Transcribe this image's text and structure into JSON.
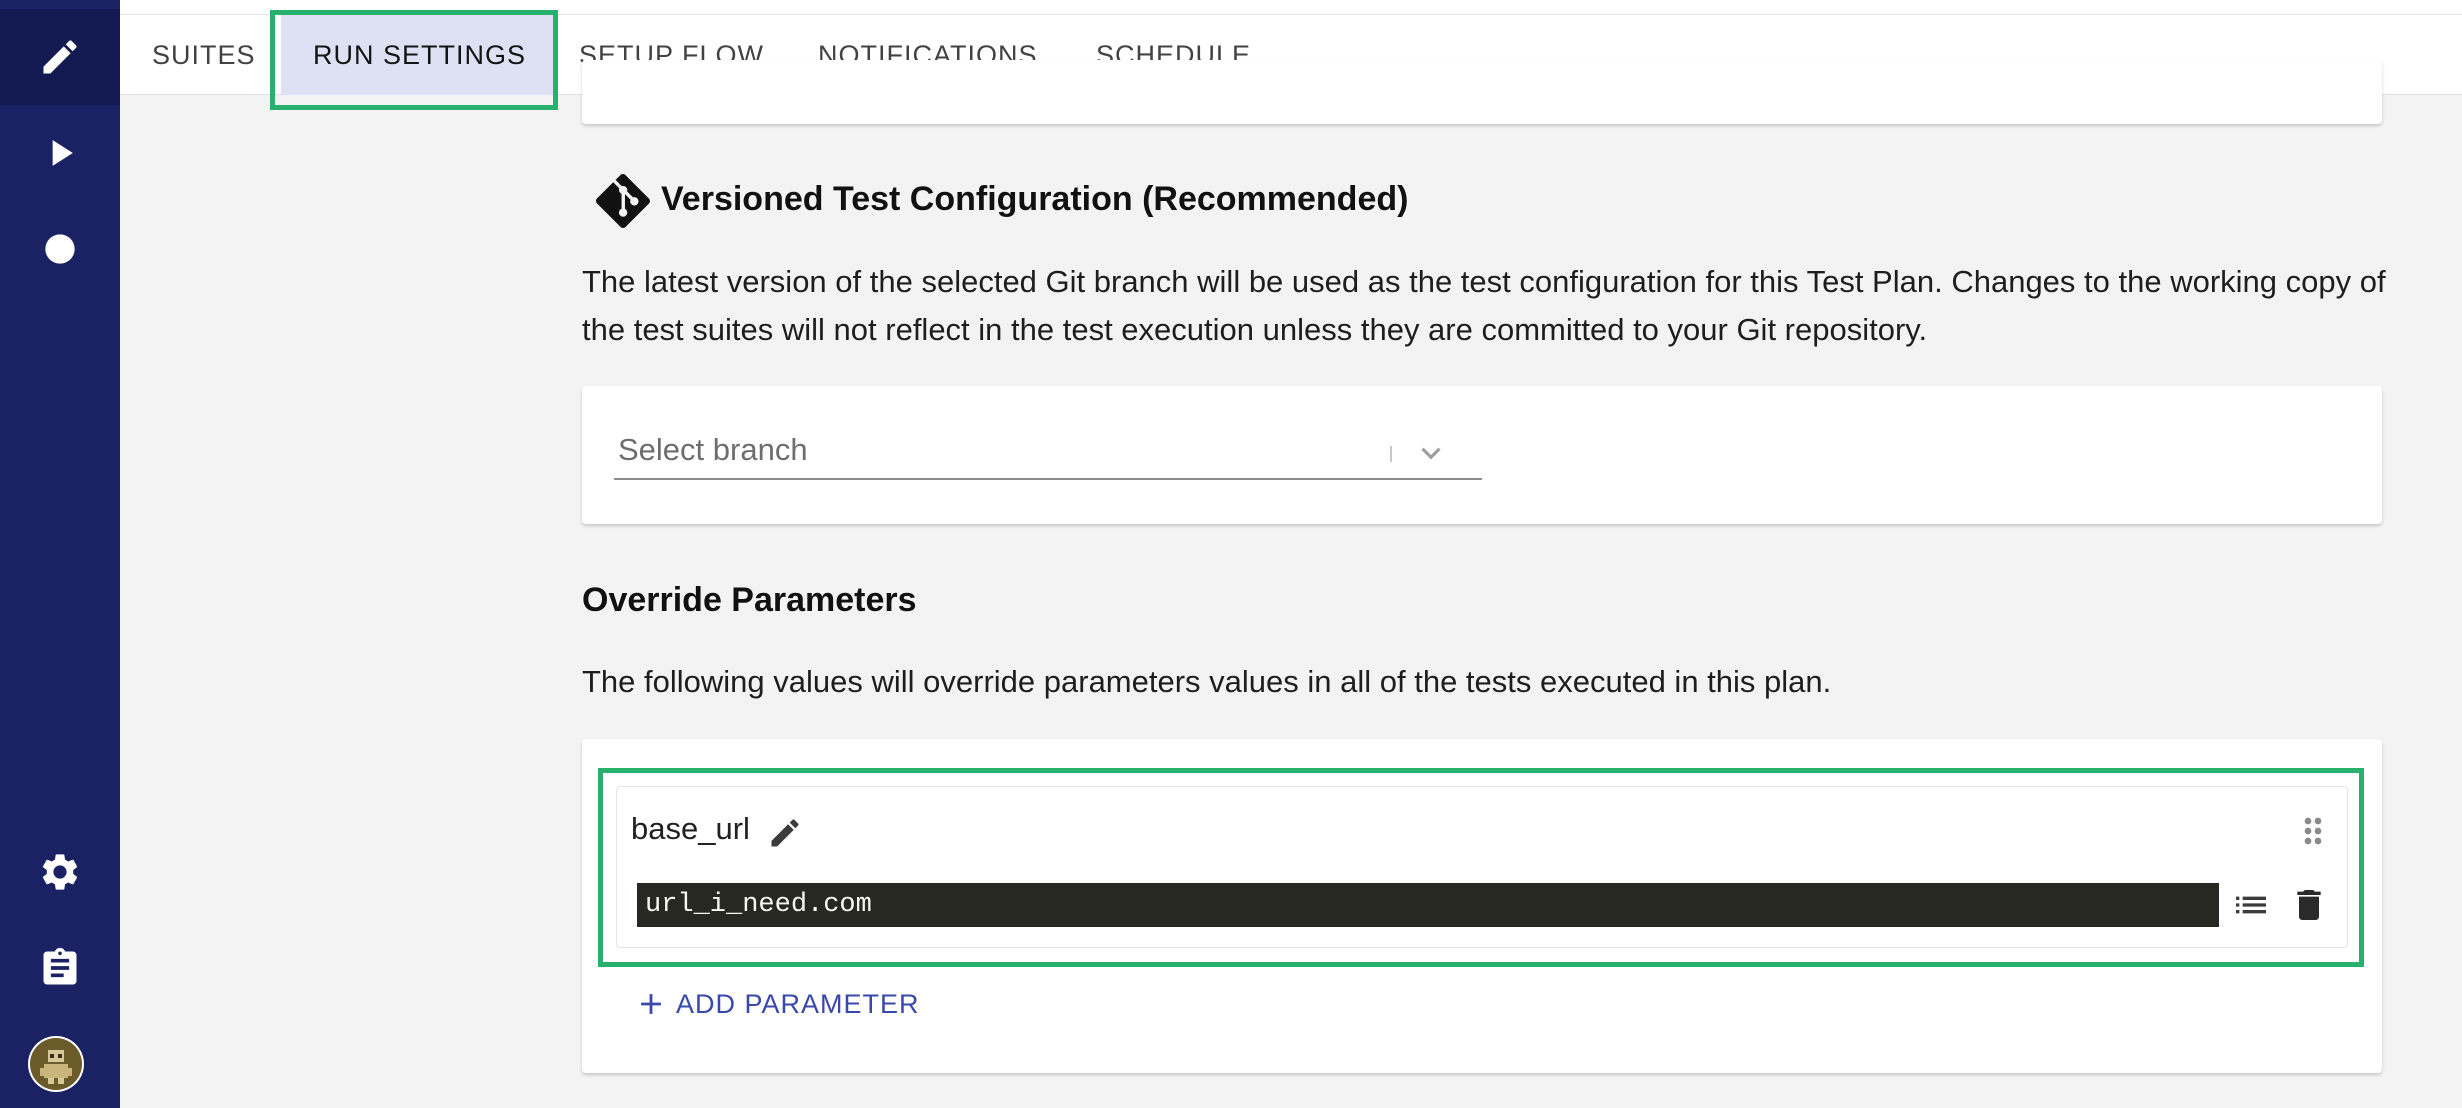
{
  "tabs": [
    {
      "label": "SUITES"
    },
    {
      "label": "RUN SETTINGS",
      "selected": true
    },
    {
      "label": "SETUP FLOW"
    },
    {
      "label": "NOTIFICATIONS"
    },
    {
      "label": "SCHEDULE"
    }
  ],
  "sidebar": {
    "items": [
      {
        "icon": "pencil-icon",
        "active": true
      },
      {
        "icon": "play-icon"
      },
      {
        "icon": "circle-icon"
      }
    ],
    "bottom_items": [
      {
        "icon": "gear-icon"
      },
      {
        "icon": "clipboard-icon"
      },
      {
        "icon": "avatar"
      }
    ]
  },
  "versioned_config": {
    "title": "Versioned Test Configuration (Recommended)",
    "description": "The latest version of the selected Git branch will be used as the test configuration for this Test Plan. Changes to the working copy of the test suites will not reflect in the test execution unless they are committed to your Git repository.",
    "branch_placeholder": "Select branch"
  },
  "override_parameters": {
    "title": "Override Parameters",
    "description": "The following values will override parameters values in all of the tests executed in this plan.",
    "parameters": [
      {
        "name": "base_url",
        "value": "url_i_need.com"
      }
    ],
    "add_label": "ADD PARAMETER"
  },
  "colors": {
    "sidebar": "#1a2263",
    "highlight": "#27b06e",
    "accent": "#3949ab",
    "selected_tab": "#dde1f3",
    "code_bg": "#272822"
  }
}
